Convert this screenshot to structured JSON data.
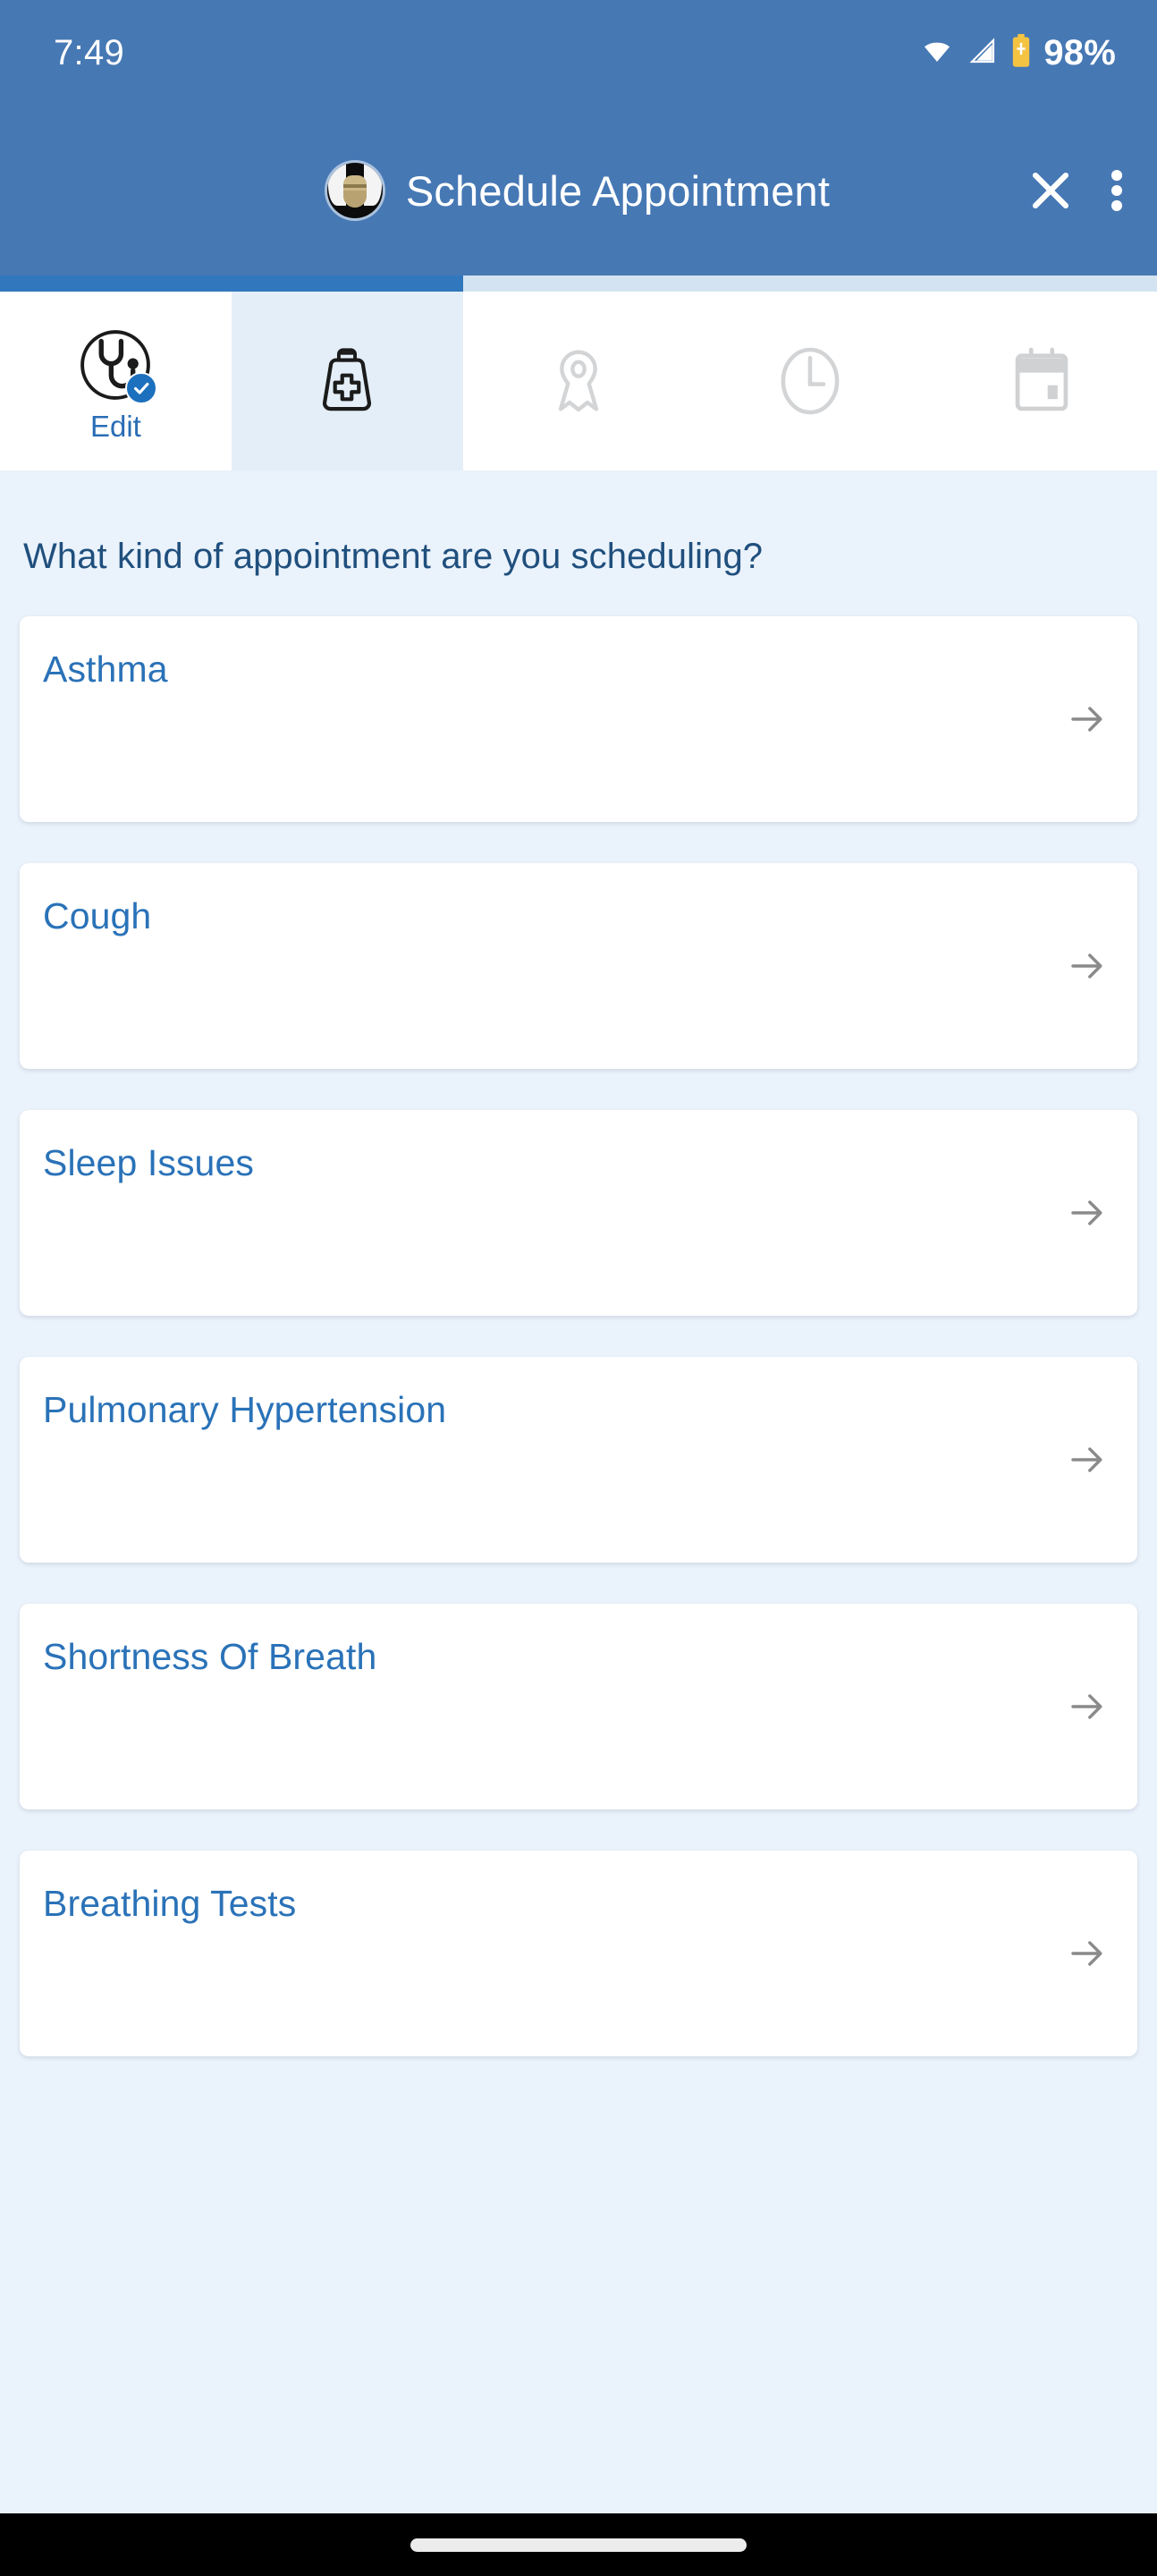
{
  "status_bar": {
    "time": "7:49",
    "battery_percent": "98%",
    "icons": [
      "wifi-icon",
      "cellular-signal-icon",
      "battery-icon"
    ]
  },
  "app_bar": {
    "title": "Schedule Appointment",
    "avatar": "user-avatar",
    "close_label": "close-icon",
    "overflow_label": "more-options-icon"
  },
  "progress": {
    "percent": 40
  },
  "tabs": [
    {
      "icon": "stethoscope-icon",
      "label": "Edit",
      "state": "completed",
      "badge": "check-badge-icon"
    },
    {
      "icon": "medical-bag-icon",
      "label": "",
      "state": "active",
      "badge": ""
    },
    {
      "icon": "location-pin-icon",
      "label": "",
      "state": "inactive",
      "badge": ""
    },
    {
      "icon": "clock-icon",
      "label": "",
      "state": "inactive",
      "badge": ""
    },
    {
      "icon": "calendar-icon",
      "label": "",
      "state": "inactive",
      "badge": ""
    }
  ],
  "main": {
    "question": "What kind of appointment are you scheduling?",
    "options": [
      {
        "label": "Asthma",
        "arrow": "arrow-right-icon"
      },
      {
        "label": "Cough",
        "arrow": "arrow-right-icon"
      },
      {
        "label": "Sleep Issues",
        "arrow": "arrow-right-icon"
      },
      {
        "label": "Pulmonary Hypertension",
        "arrow": "arrow-right-icon"
      },
      {
        "label": "Shortness Of Breath",
        "arrow": "arrow-right-icon"
      },
      {
        "label": "Breathing Tests",
        "arrow": "arrow-right-icon"
      }
    ]
  },
  "nav_bar": {
    "home_indicator": "home-indicator"
  },
  "colors": {
    "brand_blue": "#4678b4",
    "progress_fill": "#3077bd",
    "progress_track": "#d3e3f1",
    "page_background": "#eaf2fb",
    "card_background": "#ffffff",
    "card_title": "#2a72b8",
    "question_text": "#1f4f7d",
    "active_tab_background": "#e3eef8",
    "inactive_icon": "#d2d4d6",
    "battery_yellow": "#f5c342"
  }
}
